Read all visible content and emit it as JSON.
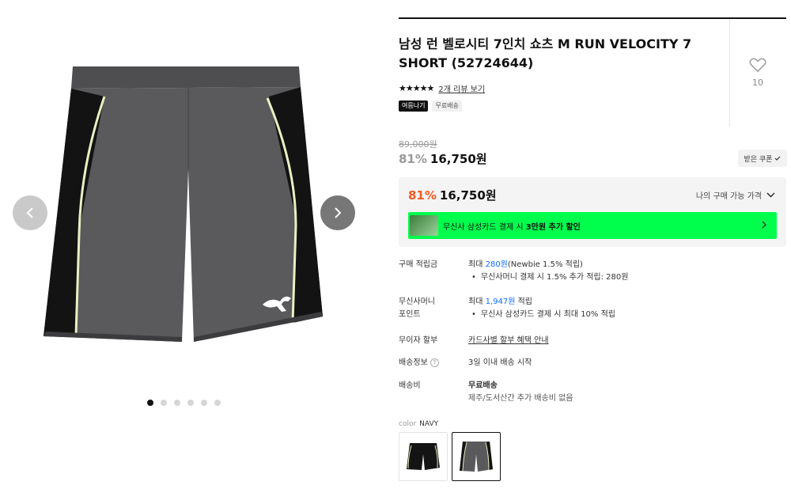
{
  "gallery": {
    "dot_count": 6,
    "active_dot": 0
  },
  "product": {
    "title": "남성 런 벨로시티 7인치 쇼츠 M RUN VELOCITY 7 SHORT (52724644)",
    "stars": "★★★★★",
    "review_link": "2개 리뷰 보기",
    "badges": [
      "여름나기",
      "무료배송"
    ],
    "like_count": "10"
  },
  "price": {
    "original": "89,000원",
    "discount": "81%",
    "sale": "16,750원",
    "coupon_button": "받은 쿠폰"
  },
  "my_price": {
    "discount": "81%",
    "price": "16,750원",
    "label": "나의 구매 가능 가격",
    "promo_text_pre": "무신사 삼성카드 결제 시 ",
    "promo_text_bold": "3만원 추가 할인"
  },
  "details": {
    "points": {
      "label": "구매 적립금",
      "line_pre": "최대 ",
      "line_amount": "280원",
      "line_post": "(Newbie 1.5% 적립)",
      "bullet": "무신사머니 결제 시 1.5% 추가 적립: 280원"
    },
    "money": {
      "label1": "무신사머니",
      "label2": "포인트",
      "line_pre": "최대 ",
      "line_amount": "1,947원",
      "line_post": " 적립",
      "bullet": "무신사 삼성카드 결제 시 최대 10% 적립"
    },
    "installment": {
      "label": "무이자 할부",
      "value": "카드사별 할부 혜택 안내"
    },
    "shipping_info": {
      "label": "배송정보",
      "value": "3일 이내 배송 시작"
    },
    "shipping_fee": {
      "label": "배송비",
      "value": "무료배송",
      "sub": "제주/도서산간 추가 배송비 없음"
    }
  },
  "color": {
    "label": "color",
    "value": "NAVY"
  },
  "colors": {
    "short_body": "#58585a",
    "short_side": "#111111",
    "piping": "#e9f2c6",
    "promo_green": "#00ff4c",
    "discount_orange": "#f15a22",
    "link_blue": "#0a6cff"
  }
}
